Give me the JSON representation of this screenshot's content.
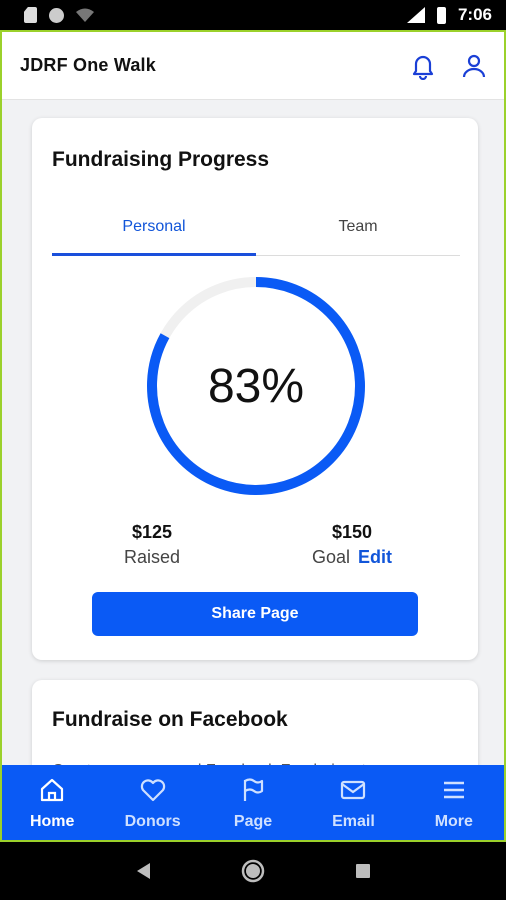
{
  "status_bar": {
    "time": "7:06",
    "network": "LTE"
  },
  "header": {
    "title": "JDRF One Walk",
    "icons": [
      "bell-icon",
      "user-icon"
    ]
  },
  "progress_card": {
    "title": "Fundraising Progress",
    "tabs": [
      {
        "label": "Personal",
        "active": true
      },
      {
        "label": "Team",
        "active": false
      }
    ],
    "percent_label": "83%",
    "progress_fraction": 0.83,
    "raised": {
      "value": "$125",
      "label": "Raised"
    },
    "goal": {
      "value": "$150",
      "label": "Goal",
      "edit_label": "Edit"
    },
    "share_label": "Share Page"
  },
  "facebook_card": {
    "title": "Fundraise on Facebook",
    "text": "Create your personal Facebook Fundraiser to"
  },
  "bottom_nav": {
    "items": [
      {
        "label": "Home",
        "icon": "home-icon",
        "active": true
      },
      {
        "label": "Donors",
        "icon": "heart-icon",
        "active": false
      },
      {
        "label": "Page",
        "icon": "flag-icon",
        "active": false
      },
      {
        "label": "Email",
        "icon": "mail-icon",
        "active": false
      },
      {
        "label": "More",
        "icon": "menu-icon",
        "active": false
      }
    ]
  },
  "colors": {
    "accent": "#0a5af5",
    "frame": "#9bd12b",
    "track": "#f0f0f0"
  }
}
